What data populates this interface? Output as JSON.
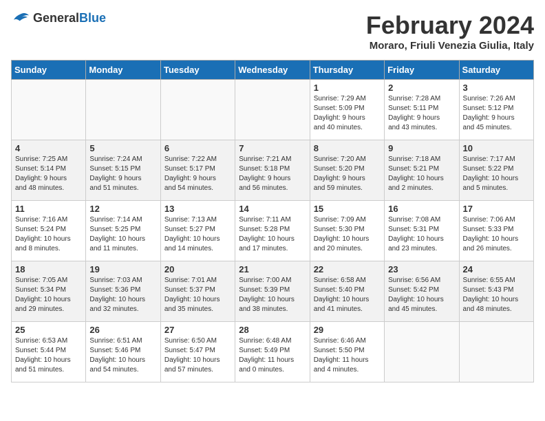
{
  "logo": {
    "general": "General",
    "blue": "Blue"
  },
  "title": "February 2024",
  "location": "Moraro, Friuli Venezia Giulia, Italy",
  "days_of_week": [
    "Sunday",
    "Monday",
    "Tuesday",
    "Wednesday",
    "Thursday",
    "Friday",
    "Saturday"
  ],
  "weeks": [
    [
      {
        "day": "",
        "info": ""
      },
      {
        "day": "",
        "info": ""
      },
      {
        "day": "",
        "info": ""
      },
      {
        "day": "",
        "info": ""
      },
      {
        "day": "1",
        "info": "Sunrise: 7:29 AM\nSunset: 5:09 PM\nDaylight: 9 hours\nand 40 minutes."
      },
      {
        "day": "2",
        "info": "Sunrise: 7:28 AM\nSunset: 5:11 PM\nDaylight: 9 hours\nand 43 minutes."
      },
      {
        "day": "3",
        "info": "Sunrise: 7:26 AM\nSunset: 5:12 PM\nDaylight: 9 hours\nand 45 minutes."
      }
    ],
    [
      {
        "day": "4",
        "info": "Sunrise: 7:25 AM\nSunset: 5:14 PM\nDaylight: 9 hours\nand 48 minutes."
      },
      {
        "day": "5",
        "info": "Sunrise: 7:24 AM\nSunset: 5:15 PM\nDaylight: 9 hours\nand 51 minutes."
      },
      {
        "day": "6",
        "info": "Sunrise: 7:22 AM\nSunset: 5:17 PM\nDaylight: 9 hours\nand 54 minutes."
      },
      {
        "day": "7",
        "info": "Sunrise: 7:21 AM\nSunset: 5:18 PM\nDaylight: 9 hours\nand 56 minutes."
      },
      {
        "day": "8",
        "info": "Sunrise: 7:20 AM\nSunset: 5:20 PM\nDaylight: 9 hours\nand 59 minutes."
      },
      {
        "day": "9",
        "info": "Sunrise: 7:18 AM\nSunset: 5:21 PM\nDaylight: 10 hours\nand 2 minutes."
      },
      {
        "day": "10",
        "info": "Sunrise: 7:17 AM\nSunset: 5:22 PM\nDaylight: 10 hours\nand 5 minutes."
      }
    ],
    [
      {
        "day": "11",
        "info": "Sunrise: 7:16 AM\nSunset: 5:24 PM\nDaylight: 10 hours\nand 8 minutes."
      },
      {
        "day": "12",
        "info": "Sunrise: 7:14 AM\nSunset: 5:25 PM\nDaylight: 10 hours\nand 11 minutes."
      },
      {
        "day": "13",
        "info": "Sunrise: 7:13 AM\nSunset: 5:27 PM\nDaylight: 10 hours\nand 14 minutes."
      },
      {
        "day": "14",
        "info": "Sunrise: 7:11 AM\nSunset: 5:28 PM\nDaylight: 10 hours\nand 17 minutes."
      },
      {
        "day": "15",
        "info": "Sunrise: 7:09 AM\nSunset: 5:30 PM\nDaylight: 10 hours\nand 20 minutes."
      },
      {
        "day": "16",
        "info": "Sunrise: 7:08 AM\nSunset: 5:31 PM\nDaylight: 10 hours\nand 23 minutes."
      },
      {
        "day": "17",
        "info": "Sunrise: 7:06 AM\nSunset: 5:33 PM\nDaylight: 10 hours\nand 26 minutes."
      }
    ],
    [
      {
        "day": "18",
        "info": "Sunrise: 7:05 AM\nSunset: 5:34 PM\nDaylight: 10 hours\nand 29 minutes."
      },
      {
        "day": "19",
        "info": "Sunrise: 7:03 AM\nSunset: 5:36 PM\nDaylight: 10 hours\nand 32 minutes."
      },
      {
        "day": "20",
        "info": "Sunrise: 7:01 AM\nSunset: 5:37 PM\nDaylight: 10 hours\nand 35 minutes."
      },
      {
        "day": "21",
        "info": "Sunrise: 7:00 AM\nSunset: 5:39 PM\nDaylight: 10 hours\nand 38 minutes."
      },
      {
        "day": "22",
        "info": "Sunrise: 6:58 AM\nSunset: 5:40 PM\nDaylight: 10 hours\nand 41 minutes."
      },
      {
        "day": "23",
        "info": "Sunrise: 6:56 AM\nSunset: 5:42 PM\nDaylight: 10 hours\nand 45 minutes."
      },
      {
        "day": "24",
        "info": "Sunrise: 6:55 AM\nSunset: 5:43 PM\nDaylight: 10 hours\nand 48 minutes."
      }
    ],
    [
      {
        "day": "25",
        "info": "Sunrise: 6:53 AM\nSunset: 5:44 PM\nDaylight: 10 hours\nand 51 minutes."
      },
      {
        "day": "26",
        "info": "Sunrise: 6:51 AM\nSunset: 5:46 PM\nDaylight: 10 hours\nand 54 minutes."
      },
      {
        "day": "27",
        "info": "Sunrise: 6:50 AM\nSunset: 5:47 PM\nDaylight: 10 hours\nand 57 minutes."
      },
      {
        "day": "28",
        "info": "Sunrise: 6:48 AM\nSunset: 5:49 PM\nDaylight: 11 hours\nand 0 minutes."
      },
      {
        "day": "29",
        "info": "Sunrise: 6:46 AM\nSunset: 5:50 PM\nDaylight: 11 hours\nand 4 minutes."
      },
      {
        "day": "",
        "info": ""
      },
      {
        "day": "",
        "info": ""
      }
    ]
  ]
}
